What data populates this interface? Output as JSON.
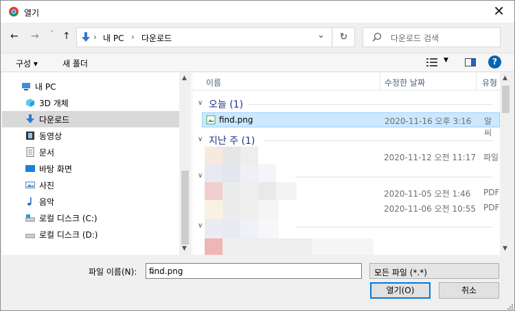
{
  "window": {
    "title": "열기"
  },
  "nav": {
    "back": "←",
    "forward": "→",
    "recent": "˅",
    "up": "↑",
    "breadcrumb": [
      "내 PC",
      "다운로드"
    ],
    "sep": "›",
    "refresh": "↻",
    "search_placeholder": "다운로드 검색"
  },
  "toolbar": {
    "organize": "구성 ▾",
    "new_folder": "새 폴더",
    "view_dd": "▼",
    "help": "?"
  },
  "sidebar": {
    "items": [
      {
        "label": "내 PC",
        "icon": "pc-icon"
      },
      {
        "label": "3D 개체",
        "icon": "cube-icon"
      },
      {
        "label": "다운로드",
        "icon": "download-icon"
      },
      {
        "label": "동영상",
        "icon": "video-icon"
      },
      {
        "label": "문서",
        "icon": "document-icon"
      },
      {
        "label": "바탕 화면",
        "icon": "desktop-icon"
      },
      {
        "label": "사진",
        "icon": "pictures-icon"
      },
      {
        "label": "음악",
        "icon": "music-icon"
      },
      {
        "label": "로컬 디스크 (C:)",
        "icon": "drive-icon"
      },
      {
        "label": "로컬 디스크 (D:)",
        "icon": "drive-icon"
      }
    ]
  },
  "columns": {
    "name": "이름",
    "date": "수정한 날짜",
    "type": "유형"
  },
  "groups": {
    "today": "오늘 (1)",
    "last_week": "지난 주 (1)"
  },
  "files": {
    "f1": {
      "name": "find.png",
      "date": "2020-11-16 오후 3:16",
      "type": "알씨"
    },
    "f2": {
      "date": "2020-11-12 오전 11:17",
      "type": "파일"
    },
    "f3": {
      "date": "2020-11-05 오전 1:46",
      "type": "PDF"
    },
    "f4": {
      "date": "2020-11-06 오전 10:55",
      "type": "PDF"
    }
  },
  "bottom": {
    "filename_label": "파일 이름(N):",
    "filename_value": "find.png",
    "filetype": "모든 파일 (*.*)",
    "open": "열기(O)",
    "cancel": "취소"
  },
  "colors": {
    "accent": "#0078d7",
    "selection": "#cce8ff",
    "group_text": "#1e3287"
  }
}
